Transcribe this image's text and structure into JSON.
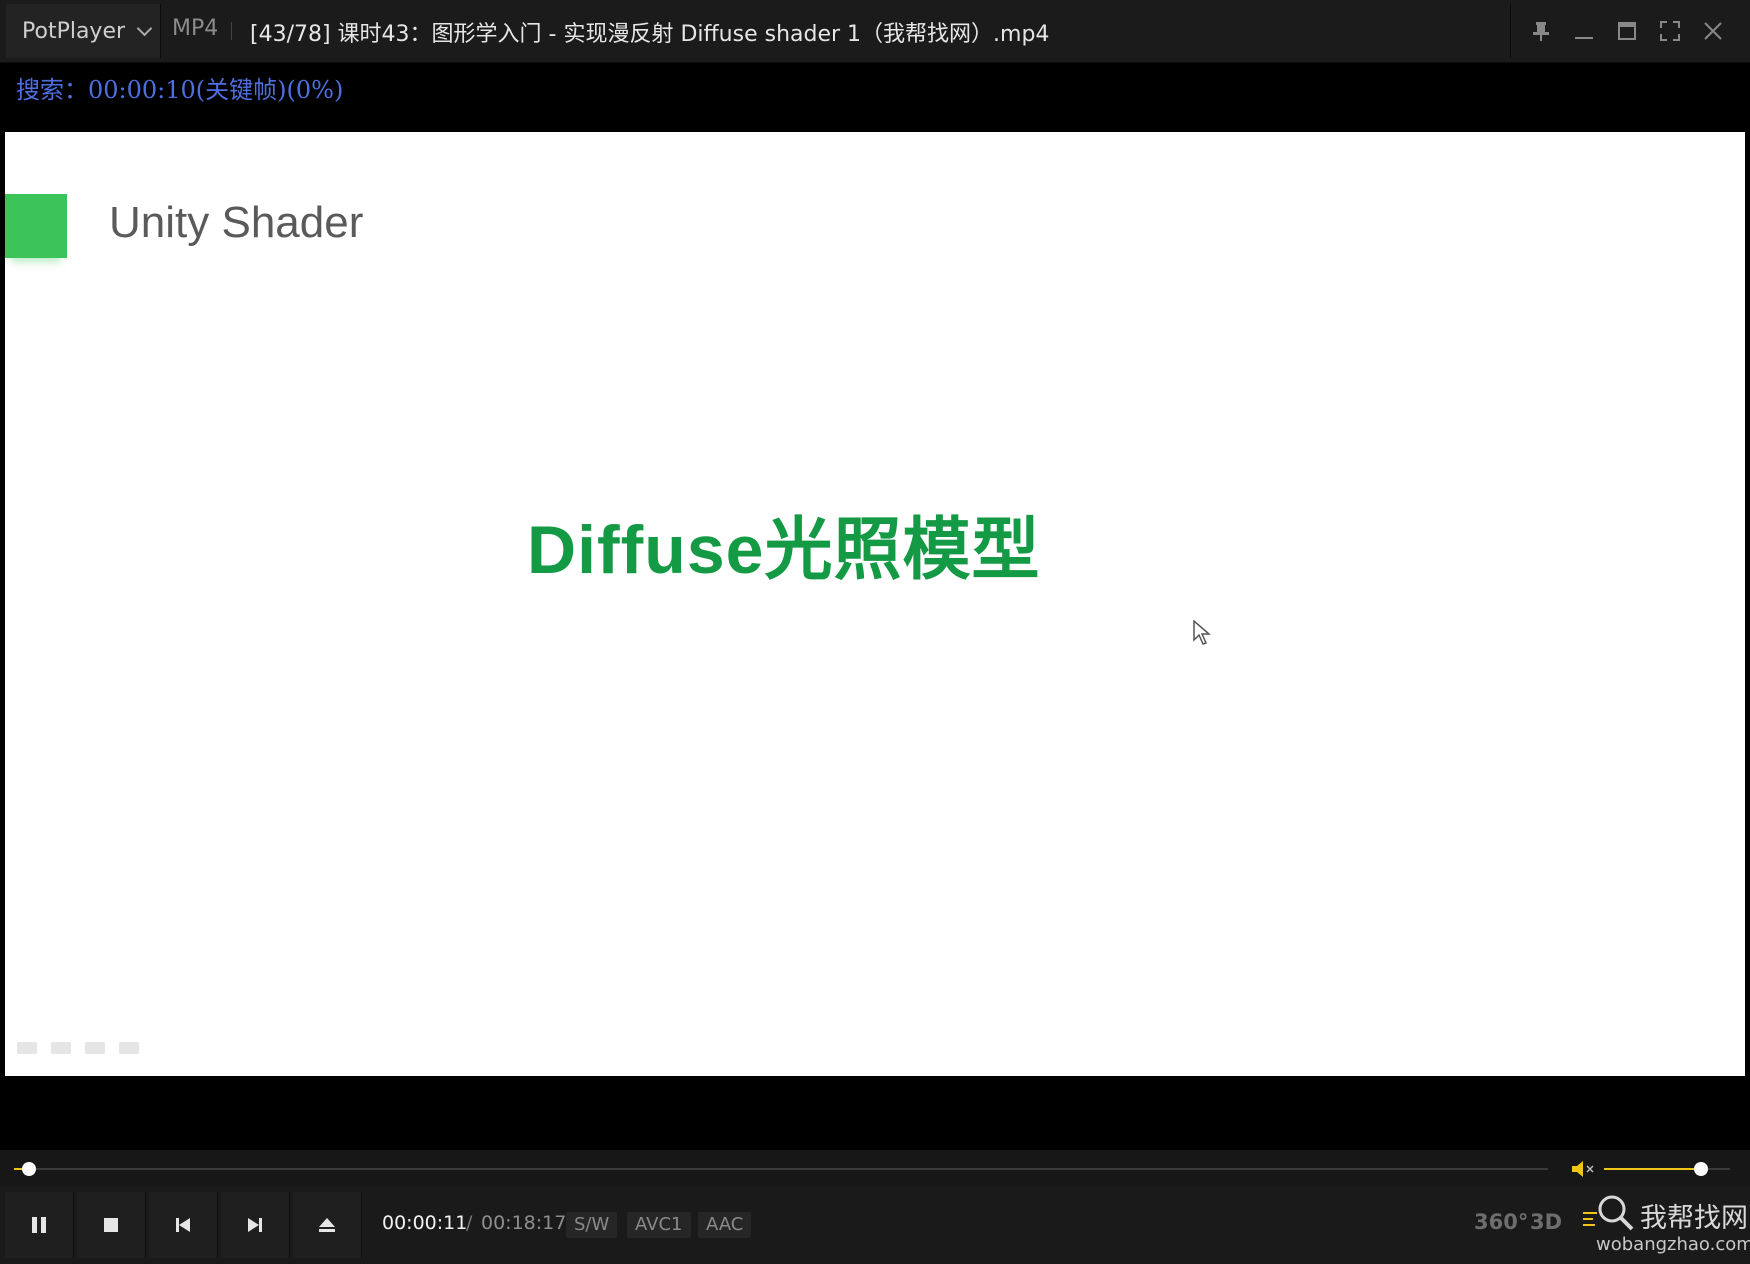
{
  "titlebar": {
    "app_name": "PotPlayer",
    "format": "MP4",
    "title": "[43/78] 课时43：图形学入门 - 实现漫反射 Diffuse shader 1（我帮找网）.mp4"
  },
  "osd": {
    "search_text": "搜索：00:00:10(关键帧)(0%)"
  },
  "slide": {
    "heading": "Unity Shader",
    "title": "Diffuse光照模型"
  },
  "playback": {
    "current_time": "00:00:11",
    "separator": "/",
    "total_time": "00:18:17",
    "progress_fraction": 0.01,
    "volume_fraction": 0.77
  },
  "badges": {
    "decoder": "S/W",
    "video_codec": "AVC1",
    "audio_codec": "AAC"
  },
  "extra_buttons": {
    "vr": "360°",
    "stereo": "3D"
  },
  "watermark": {
    "name": "我帮找网",
    "url": "wobangzhao.com"
  },
  "colors": {
    "accent": "#f0c419",
    "osd": "#4f6fe0",
    "slide_green": "#149a45",
    "slide_square": "#3cc359"
  }
}
